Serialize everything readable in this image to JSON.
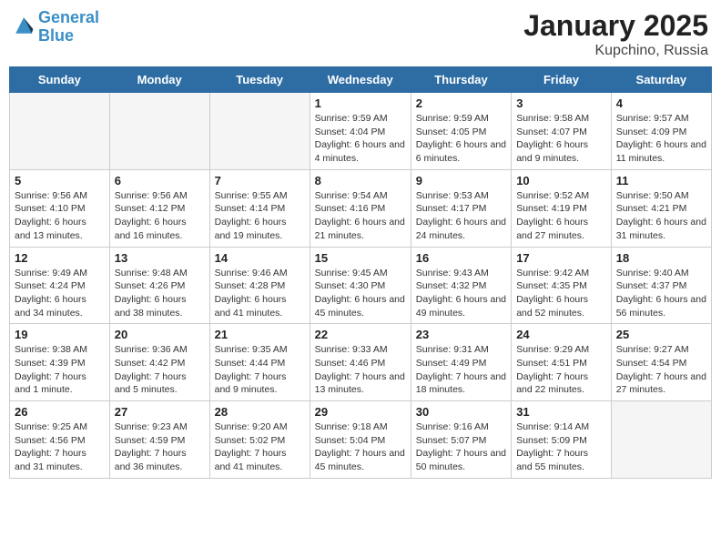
{
  "header": {
    "logo_line1": "General",
    "logo_line2": "Blue",
    "month": "January 2025",
    "location": "Kupchino, Russia"
  },
  "weekdays": [
    "Sunday",
    "Monday",
    "Tuesday",
    "Wednesday",
    "Thursday",
    "Friday",
    "Saturday"
  ],
  "weeks": [
    [
      {
        "day": "",
        "info": ""
      },
      {
        "day": "",
        "info": ""
      },
      {
        "day": "",
        "info": ""
      },
      {
        "day": "1",
        "info": "Sunrise: 9:59 AM\nSunset: 4:04 PM\nDaylight: 6 hours and 4 minutes."
      },
      {
        "day": "2",
        "info": "Sunrise: 9:59 AM\nSunset: 4:05 PM\nDaylight: 6 hours and 6 minutes."
      },
      {
        "day": "3",
        "info": "Sunrise: 9:58 AM\nSunset: 4:07 PM\nDaylight: 6 hours and 9 minutes."
      },
      {
        "day": "4",
        "info": "Sunrise: 9:57 AM\nSunset: 4:09 PM\nDaylight: 6 hours and 11 minutes."
      }
    ],
    [
      {
        "day": "5",
        "info": "Sunrise: 9:56 AM\nSunset: 4:10 PM\nDaylight: 6 hours and 13 minutes."
      },
      {
        "day": "6",
        "info": "Sunrise: 9:56 AM\nSunset: 4:12 PM\nDaylight: 6 hours and 16 minutes."
      },
      {
        "day": "7",
        "info": "Sunrise: 9:55 AM\nSunset: 4:14 PM\nDaylight: 6 hours and 19 minutes."
      },
      {
        "day": "8",
        "info": "Sunrise: 9:54 AM\nSunset: 4:16 PM\nDaylight: 6 hours and 21 minutes."
      },
      {
        "day": "9",
        "info": "Sunrise: 9:53 AM\nSunset: 4:17 PM\nDaylight: 6 hours and 24 minutes."
      },
      {
        "day": "10",
        "info": "Sunrise: 9:52 AM\nSunset: 4:19 PM\nDaylight: 6 hours and 27 minutes."
      },
      {
        "day": "11",
        "info": "Sunrise: 9:50 AM\nSunset: 4:21 PM\nDaylight: 6 hours and 31 minutes."
      }
    ],
    [
      {
        "day": "12",
        "info": "Sunrise: 9:49 AM\nSunset: 4:24 PM\nDaylight: 6 hours and 34 minutes."
      },
      {
        "day": "13",
        "info": "Sunrise: 9:48 AM\nSunset: 4:26 PM\nDaylight: 6 hours and 38 minutes."
      },
      {
        "day": "14",
        "info": "Sunrise: 9:46 AM\nSunset: 4:28 PM\nDaylight: 6 hours and 41 minutes."
      },
      {
        "day": "15",
        "info": "Sunrise: 9:45 AM\nSunset: 4:30 PM\nDaylight: 6 hours and 45 minutes."
      },
      {
        "day": "16",
        "info": "Sunrise: 9:43 AM\nSunset: 4:32 PM\nDaylight: 6 hours and 49 minutes."
      },
      {
        "day": "17",
        "info": "Sunrise: 9:42 AM\nSunset: 4:35 PM\nDaylight: 6 hours and 52 minutes."
      },
      {
        "day": "18",
        "info": "Sunrise: 9:40 AM\nSunset: 4:37 PM\nDaylight: 6 hours and 56 minutes."
      }
    ],
    [
      {
        "day": "19",
        "info": "Sunrise: 9:38 AM\nSunset: 4:39 PM\nDaylight: 7 hours and 1 minute."
      },
      {
        "day": "20",
        "info": "Sunrise: 9:36 AM\nSunset: 4:42 PM\nDaylight: 7 hours and 5 minutes."
      },
      {
        "day": "21",
        "info": "Sunrise: 9:35 AM\nSunset: 4:44 PM\nDaylight: 7 hours and 9 minutes."
      },
      {
        "day": "22",
        "info": "Sunrise: 9:33 AM\nSunset: 4:46 PM\nDaylight: 7 hours and 13 minutes."
      },
      {
        "day": "23",
        "info": "Sunrise: 9:31 AM\nSunset: 4:49 PM\nDaylight: 7 hours and 18 minutes."
      },
      {
        "day": "24",
        "info": "Sunrise: 9:29 AM\nSunset: 4:51 PM\nDaylight: 7 hours and 22 minutes."
      },
      {
        "day": "25",
        "info": "Sunrise: 9:27 AM\nSunset: 4:54 PM\nDaylight: 7 hours and 27 minutes."
      }
    ],
    [
      {
        "day": "26",
        "info": "Sunrise: 9:25 AM\nSunset: 4:56 PM\nDaylight: 7 hours and 31 minutes."
      },
      {
        "day": "27",
        "info": "Sunrise: 9:23 AM\nSunset: 4:59 PM\nDaylight: 7 hours and 36 minutes."
      },
      {
        "day": "28",
        "info": "Sunrise: 9:20 AM\nSunset: 5:02 PM\nDaylight: 7 hours and 41 minutes."
      },
      {
        "day": "29",
        "info": "Sunrise: 9:18 AM\nSunset: 5:04 PM\nDaylight: 7 hours and 45 minutes."
      },
      {
        "day": "30",
        "info": "Sunrise: 9:16 AM\nSunset: 5:07 PM\nDaylight: 7 hours and 50 minutes."
      },
      {
        "day": "31",
        "info": "Sunrise: 9:14 AM\nSunset: 5:09 PM\nDaylight: 7 hours and 55 minutes."
      },
      {
        "day": "",
        "info": ""
      }
    ]
  ]
}
